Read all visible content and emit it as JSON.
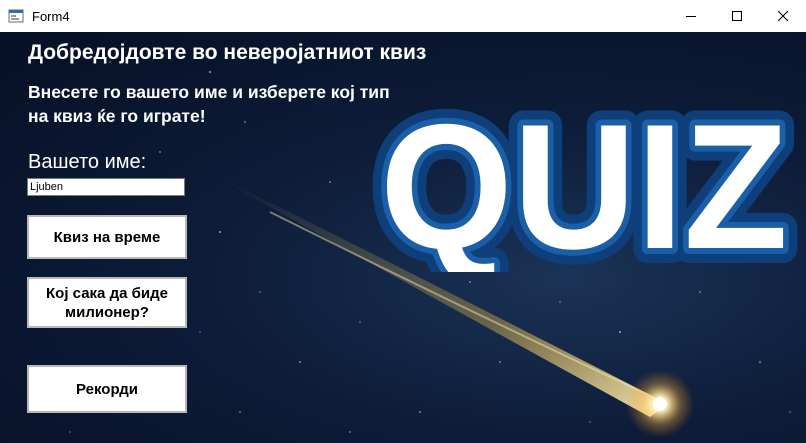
{
  "window": {
    "title": "Form4"
  },
  "main": {
    "heading": "Добредојдовте во неверојатниот квиз",
    "instruction": "Внесете го вашето име и изберете кој тип на квиз ќе го играте!",
    "name_label": "Вашето име:",
    "name_value": "Ljuben",
    "buttons": {
      "timed_quiz": "Квиз на време",
      "millionaire": "Кој сака да биде милионер?",
      "records": "Рекорди"
    },
    "logo_text": "QUIZ"
  },
  "colors": {
    "background": "#0a1428",
    "logo_fill": "#ffffff",
    "logo_outline": "#1a5fa8"
  },
  "icons": [
    "app-icon",
    "minimize-icon",
    "maximize-icon",
    "close-icon"
  ]
}
